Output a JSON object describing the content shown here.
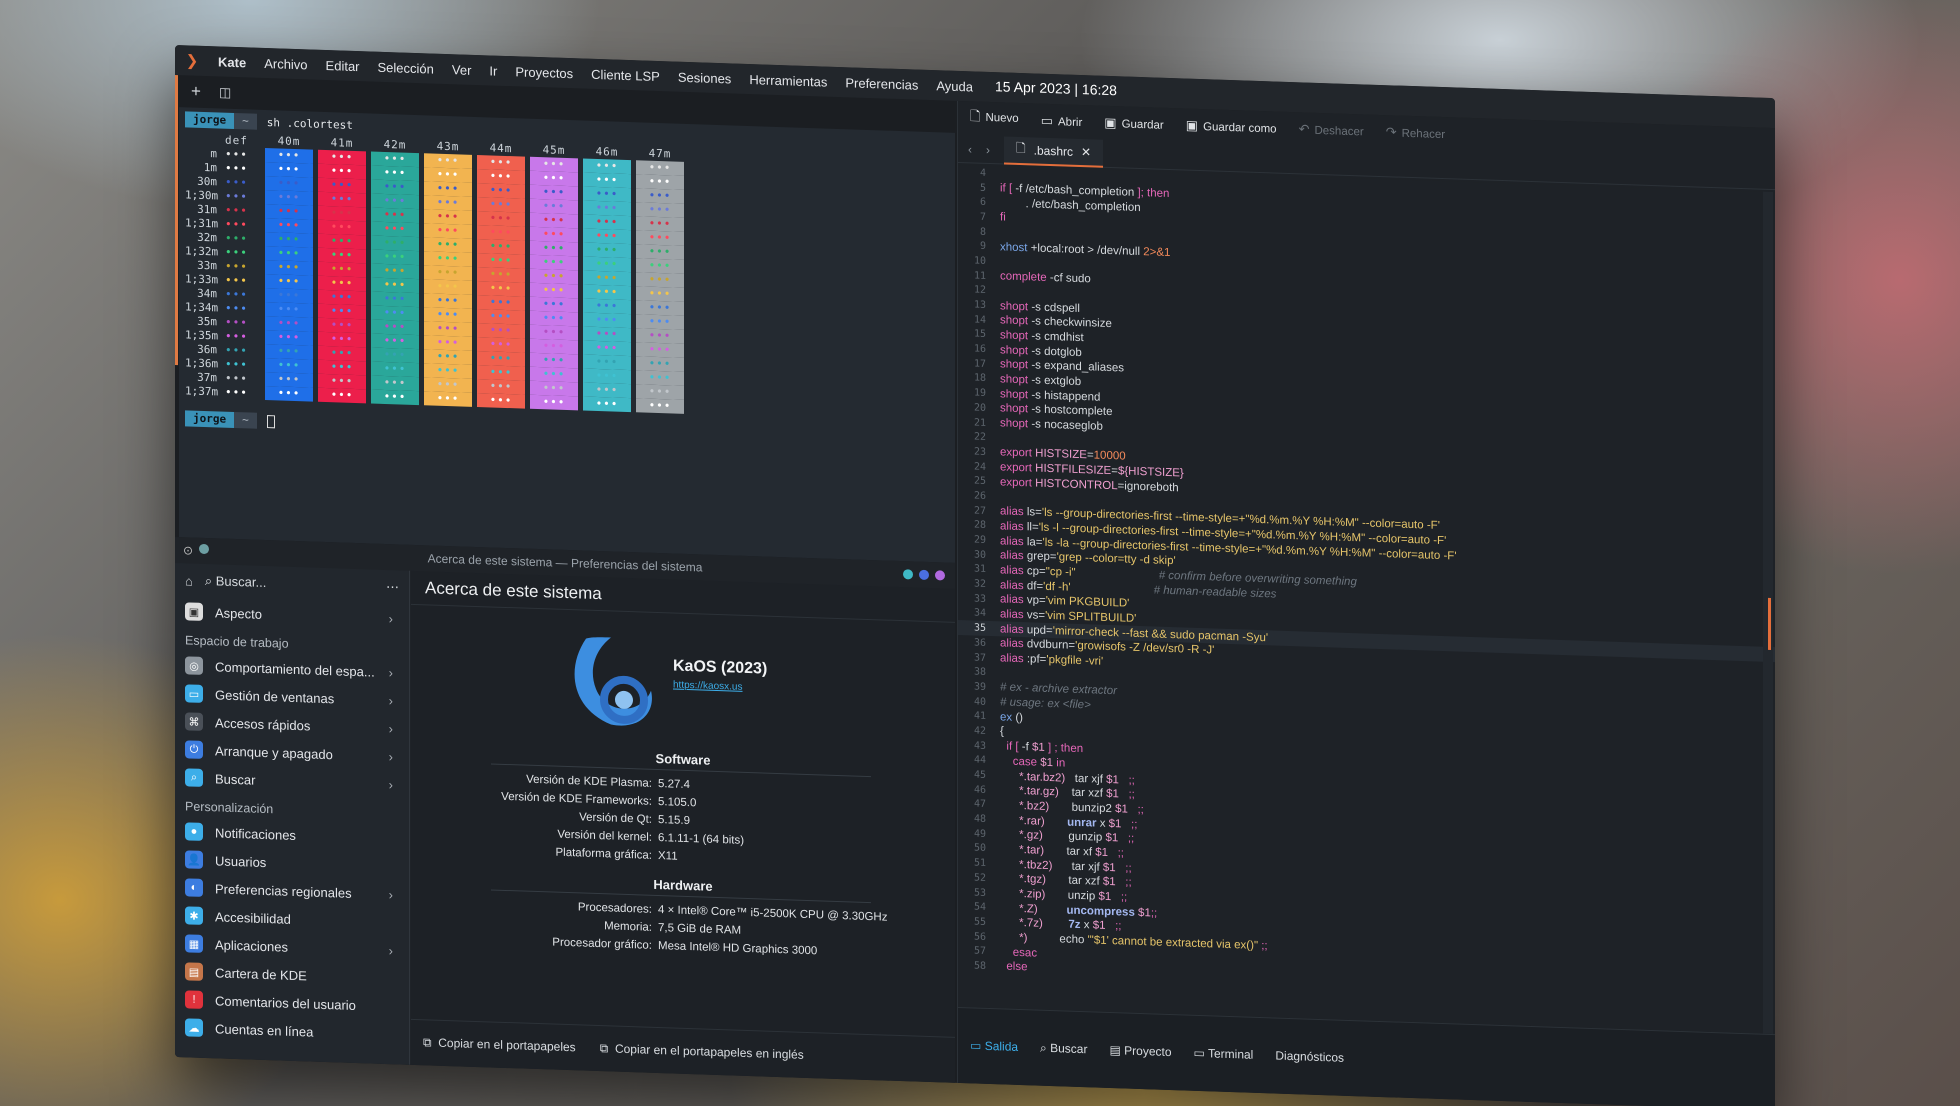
{
  "menubar": {
    "app": "Kate",
    "items": [
      "Archivo",
      "Editar",
      "Selección",
      "Ver",
      "Ir",
      "Proyectos",
      "Cliente LSP",
      "Sesiones",
      "Herramientas",
      "Preferencias",
      "Ayuda"
    ],
    "clock": "15 Apr 2023 | 16:28"
  },
  "terminal": {
    "user": "jorge",
    "tilde": "~",
    "command": "sh .colortest",
    "headers": [
      "def",
      "40m",
      "41m",
      "42m",
      "43m",
      "44m",
      "45m",
      "46m",
      "47m"
    ],
    "rows": [
      "m",
      "1m",
      "30m",
      "1;30m",
      "31m",
      "1;31m",
      "32m",
      "1;32m",
      "33m",
      "1;33m",
      "34m",
      "1;34m",
      "35m",
      "1;35m",
      "36m",
      "1;36m",
      "37m",
      "1;37m"
    ],
    "cell_text": "•••",
    "bg_colors": [
      "#1f6fe8",
      "#ec1f4b",
      "#2aa79a",
      "#f2b450",
      "#f0604e",
      "#c878ea",
      "#3fb9c6",
      "#9ea4a8"
    ],
    "fg_colors": [
      "#e6e6e6",
      "#ffffff",
      "#3a5cc9",
      "#6b7bd9",
      "#d6334b",
      "#ff4a5e",
      "#2eae6a",
      "#3bd07c",
      "#c7a52f",
      "#f3c54b",
      "#3b77d8",
      "#4d8cf2",
      "#b44fc4",
      "#d45ee0",
      "#33a3b2",
      "#3fc2d2",
      "#c2c7cc",
      "#ffffff"
    ]
  },
  "settings": {
    "window_title": "Acerca de este sistema — Preferencias del sistema",
    "search_placeholder": "Buscar...",
    "top_item": "Aspecto",
    "section_work": "Espacio de trabajo",
    "work_items": [
      "Comportamiento del espa...",
      "Gestión de ventanas",
      "Accesos rápidos",
      "Arranque y apagado",
      "Buscar"
    ],
    "section_pers": "Personalización",
    "pers_items": [
      "Notificaciones",
      "Usuarios",
      "Preferencias regionales",
      "Accesibilidad",
      "Aplicaciones",
      "Cartera de KDE",
      "Comentarios del usuario",
      "Cuentas en línea"
    ],
    "page_title": "Acerca de este sistema",
    "os_name": "KaOS (2023)",
    "os_url": "https://kaosx.us",
    "software_title": "Software",
    "software": [
      [
        "Versión de KDE Plasma:",
        "5.27.4"
      ],
      [
        "Versión de KDE Frameworks:",
        "5.105.0"
      ],
      [
        "Versión de Qt:",
        "5.15.9"
      ],
      [
        "Versión del kernel:",
        "6.1.11-1 (64 bits)"
      ],
      [
        "Plataforma gráfica:",
        "X11"
      ]
    ],
    "hardware_title": "Hardware",
    "hardware": [
      [
        "Procesadores:",
        "4 × Intel® Core™ i5-2500K CPU @ 3.30GHz"
      ],
      [
        "Memoria:",
        "7,5 GiB de RAM"
      ],
      [
        "Procesador gráfico:",
        "Mesa Intel® HD Graphics 3000"
      ]
    ],
    "copy_btn": "Copiar en el portapapeles",
    "copy_en_btn": "Copiar en el portapapeles en inglés"
  },
  "editor": {
    "toolbar": {
      "new": "Nuevo",
      "open": "Abrir",
      "save": "Guardar",
      "save_as": "Guardar como",
      "undo": "Deshacer",
      "redo": "Rehacer"
    },
    "tab": ".bashrc",
    "bottom_tabs": [
      "Salida",
      "Buscar",
      "Proyecto",
      "Terminal",
      "Diagnósticos"
    ],
    "current_line": 35,
    "lines": [
      {
        "n": "4",
        "t": []
      },
      {
        "n": "5",
        "t": [
          [
            "kw",
            "if [ "
          ],
          [
            "tx",
            "-f /etc/bash_completion "
          ],
          [
            "kw",
            "]; then"
          ]
        ]
      },
      {
        "n": "6",
        "t": [
          [
            "tx",
            "        . /etc/bash_completion"
          ]
        ]
      },
      {
        "n": "7",
        "t": [
          [
            "kw",
            "fi"
          ]
        ]
      },
      {
        "n": "8",
        "t": []
      },
      {
        "n": "9",
        "t": [
          [
            "fn",
            "xhost "
          ],
          [
            "tx",
            "+local:root > /dev/null "
          ],
          [
            "nm",
            "2>&1"
          ]
        ]
      },
      {
        "n": "10",
        "t": []
      },
      {
        "n": "11",
        "t": [
          [
            "kw",
            "complete "
          ],
          [
            "tx",
            "-cf sudo"
          ]
        ]
      },
      {
        "n": "12",
        "t": []
      },
      {
        "n": "13",
        "t": [
          [
            "kw",
            "shopt "
          ],
          [
            "tx",
            "-s cdspell"
          ]
        ]
      },
      {
        "n": "14",
        "t": [
          [
            "kw",
            "shopt "
          ],
          [
            "tx",
            "-s checkwinsize"
          ]
        ]
      },
      {
        "n": "15",
        "t": [
          [
            "kw",
            "shopt "
          ],
          [
            "tx",
            "-s cmdhist"
          ]
        ]
      },
      {
        "n": "16",
        "t": [
          [
            "kw",
            "shopt "
          ],
          [
            "tx",
            "-s dotglob"
          ]
        ]
      },
      {
        "n": "17",
        "t": [
          [
            "kw",
            "shopt "
          ],
          [
            "tx",
            "-s expand_aliases"
          ]
        ]
      },
      {
        "n": "18",
        "t": [
          [
            "kw",
            "shopt "
          ],
          [
            "tx",
            "-s extglob"
          ]
        ]
      },
      {
        "n": "19",
        "t": [
          [
            "kw",
            "shopt "
          ],
          [
            "tx",
            "-s histappend"
          ]
        ]
      },
      {
        "n": "20",
        "t": [
          [
            "kw",
            "shopt "
          ],
          [
            "tx",
            "-s hostcomplete"
          ]
        ]
      },
      {
        "n": "21",
        "t": [
          [
            "kw",
            "shopt "
          ],
          [
            "tx",
            "-s nocaseglob"
          ]
        ]
      },
      {
        "n": "22",
        "t": []
      },
      {
        "n": "23",
        "t": [
          [
            "kw",
            "export "
          ],
          [
            "vr",
            "HISTSIZE"
          ],
          [
            "tx",
            "="
          ],
          [
            "nm",
            "10000"
          ]
        ]
      },
      {
        "n": "24",
        "t": [
          [
            "kw",
            "export "
          ],
          [
            "vr",
            "HISTFILESIZE"
          ],
          [
            "tx",
            "="
          ],
          [
            "vr",
            "${HISTSIZE}"
          ]
        ]
      },
      {
        "n": "25",
        "t": [
          [
            "kw",
            "export "
          ],
          [
            "vr",
            "HISTCONTROL"
          ],
          [
            "tx",
            "=ignoreboth"
          ]
        ]
      },
      {
        "n": "26",
        "t": []
      },
      {
        "n": "27",
        "t": [
          [
            "kw",
            "alias "
          ],
          [
            "tx",
            "ls="
          ],
          [
            "st",
            "'ls --group-directories-first --time-style=+\"%d.%m.%Y %H:%M\" --color=auto -F'"
          ]
        ]
      },
      {
        "n": "28",
        "t": [
          [
            "kw",
            "alias "
          ],
          [
            "tx",
            "ll="
          ],
          [
            "st",
            "'ls -l --group-directories-first --time-style=+\"%d.%m.%Y %H:%M\" --color=auto -F'"
          ]
        ]
      },
      {
        "n": "29",
        "t": [
          [
            "kw",
            "alias "
          ],
          [
            "tx",
            "la="
          ],
          [
            "st",
            "'ls -la --group-directories-first --time-style=+\"%d.%m.%Y %H:%M\" --color=auto -F'"
          ]
        ]
      },
      {
        "n": "30",
        "t": [
          [
            "kw",
            "alias "
          ],
          [
            "tx",
            "grep="
          ],
          [
            "st",
            "'grep --color=tty -d skip'"
          ]
        ]
      },
      {
        "n": "31",
        "t": [
          [
            "kw",
            "alias "
          ],
          [
            "tx",
            "cp="
          ],
          [
            "st",
            "\"cp -i\"                          "
          ],
          [
            "cm",
            "# confirm before overwriting something"
          ]
        ]
      },
      {
        "n": "32",
        "t": [
          [
            "kw",
            "alias "
          ],
          [
            "tx",
            "df="
          ],
          [
            "st",
            "'df -h'                          "
          ],
          [
            "cm",
            "# human-readable sizes"
          ]
        ]
      },
      {
        "n": "33",
        "t": [
          [
            "kw",
            "alias "
          ],
          [
            "tx",
            "vp="
          ],
          [
            "st",
            "'vim PKGBUILD'"
          ]
        ]
      },
      {
        "n": "34",
        "t": [
          [
            "kw",
            "alias "
          ],
          [
            "tx",
            "vs="
          ],
          [
            "st",
            "'vim SPLITBUILD'"
          ]
        ]
      },
      {
        "n": "35",
        "t": [
          [
            "kw",
            "alias "
          ],
          [
            "tx",
            "upd="
          ],
          [
            "st",
            "'mirror-check --fast && sudo pacman -Syu'"
          ]
        ]
      },
      {
        "n": "36",
        "t": [
          [
            "kw",
            "alias "
          ],
          [
            "tx",
            "dvdburn="
          ],
          [
            "st",
            "'growisofs -Z /dev/sr0 -R -J'"
          ]
        ]
      },
      {
        "n": "37",
        "t": [
          [
            "kw",
            "alias "
          ],
          [
            "tx",
            ":pf="
          ],
          [
            "st",
            "'pkgfile -vri'"
          ]
        ]
      },
      {
        "n": "38",
        "t": []
      },
      {
        "n": "39",
        "t": [
          [
            "cm",
            "# ex - archive extractor"
          ]
        ]
      },
      {
        "n": "40",
        "t": [
          [
            "cm",
            "# usage: ex <file>"
          ]
        ]
      },
      {
        "n": "41",
        "t": [
          [
            "fn",
            "ex"
          ],
          [
            "tx",
            " ()"
          ]
        ]
      },
      {
        "n": "42",
        "t": [
          [
            "tx",
            "{"
          ]
        ]
      },
      {
        "n": "43",
        "t": [
          [
            "kw",
            "  if [ "
          ],
          [
            "tx",
            "-f "
          ],
          [
            "vr",
            "$1"
          ],
          [
            "kw",
            " ] ; then"
          ]
        ]
      },
      {
        "n": "44",
        "t": [
          [
            "kw",
            "    case "
          ],
          [
            "vr",
            "$1"
          ],
          [
            "kw",
            " in"
          ]
        ]
      },
      {
        "n": "45",
        "t": [
          [
            "vr",
            "      *.tar.bz2)"
          ],
          [
            "tx",
            "   tar xjf "
          ],
          [
            "vr",
            "$1"
          ],
          [
            "kw",
            "   ;;"
          ]
        ]
      },
      {
        "n": "46",
        "t": [
          [
            "vr",
            "      *.tar.gz)"
          ],
          [
            "tx",
            "    tar xzf "
          ],
          [
            "vr",
            "$1"
          ],
          [
            "kw",
            "   ;;"
          ]
        ]
      },
      {
        "n": "47",
        "t": [
          [
            "vr",
            "      *.bz2)"
          ],
          [
            "tx",
            "       bunzip2 "
          ],
          [
            "vr",
            "$1"
          ],
          [
            "kw",
            "   ;;"
          ]
        ]
      },
      {
        "n": "48",
        "t": [
          [
            "vr",
            "      *.rar)"
          ],
          [
            "bl",
            "       unrar"
          ],
          [
            "tx",
            " x "
          ],
          [
            "vr",
            "$1"
          ],
          [
            "kw",
            "   ;;"
          ]
        ]
      },
      {
        "n": "49",
        "t": [
          [
            "vr",
            "      *.gz)"
          ],
          [
            "tx",
            "        gunzip "
          ],
          [
            "vr",
            "$1"
          ],
          [
            "kw",
            "   ;;"
          ]
        ]
      },
      {
        "n": "50",
        "t": [
          [
            "vr",
            "      *.tar)"
          ],
          [
            "tx",
            "       tar xf "
          ],
          [
            "vr",
            "$1"
          ],
          [
            "kw",
            "   ;;"
          ]
        ]
      },
      {
        "n": "51",
        "t": [
          [
            "vr",
            "      *.tbz2)"
          ],
          [
            "tx",
            "      tar xjf "
          ],
          [
            "vr",
            "$1"
          ],
          [
            "kw",
            "   ;;"
          ]
        ]
      },
      {
        "n": "52",
        "t": [
          [
            "vr",
            "      *.tgz)"
          ],
          [
            "tx",
            "       tar xzf "
          ],
          [
            "vr",
            "$1"
          ],
          [
            "kw",
            "   ;;"
          ]
        ]
      },
      {
        "n": "53",
        "t": [
          [
            "vr",
            "      *.zip)"
          ],
          [
            "tx",
            "       unzip "
          ],
          [
            "vr",
            "$1"
          ],
          [
            "kw",
            "   ;;"
          ]
        ]
      },
      {
        "n": "54",
        "t": [
          [
            "vr",
            "      *.Z)"
          ],
          [
            "bl",
            "         uncompress"
          ],
          [
            "tx",
            " "
          ],
          [
            "vr",
            "$1"
          ],
          [
            "kw",
            ";;"
          ]
        ]
      },
      {
        "n": "55",
        "t": [
          [
            "vr",
            "      *.7z)"
          ],
          [
            "bl",
            "        7z"
          ],
          [
            "tx",
            " x "
          ],
          [
            "vr",
            "$1"
          ],
          [
            "kw",
            "   ;;"
          ]
        ]
      },
      {
        "n": "56",
        "t": [
          [
            "vr",
            "      *)"
          ],
          [
            "tx",
            "          echo "
          ],
          [
            "st",
            "\"'$1' cannot be extracted via ex()\""
          ],
          [
            "kw",
            " ;;"
          ]
        ]
      },
      {
        "n": "57",
        "t": [
          [
            "kw",
            "    esac"
          ]
        ]
      },
      {
        "n": "58",
        "t": [
          [
            "kw",
            "  else"
          ]
        ]
      }
    ]
  }
}
